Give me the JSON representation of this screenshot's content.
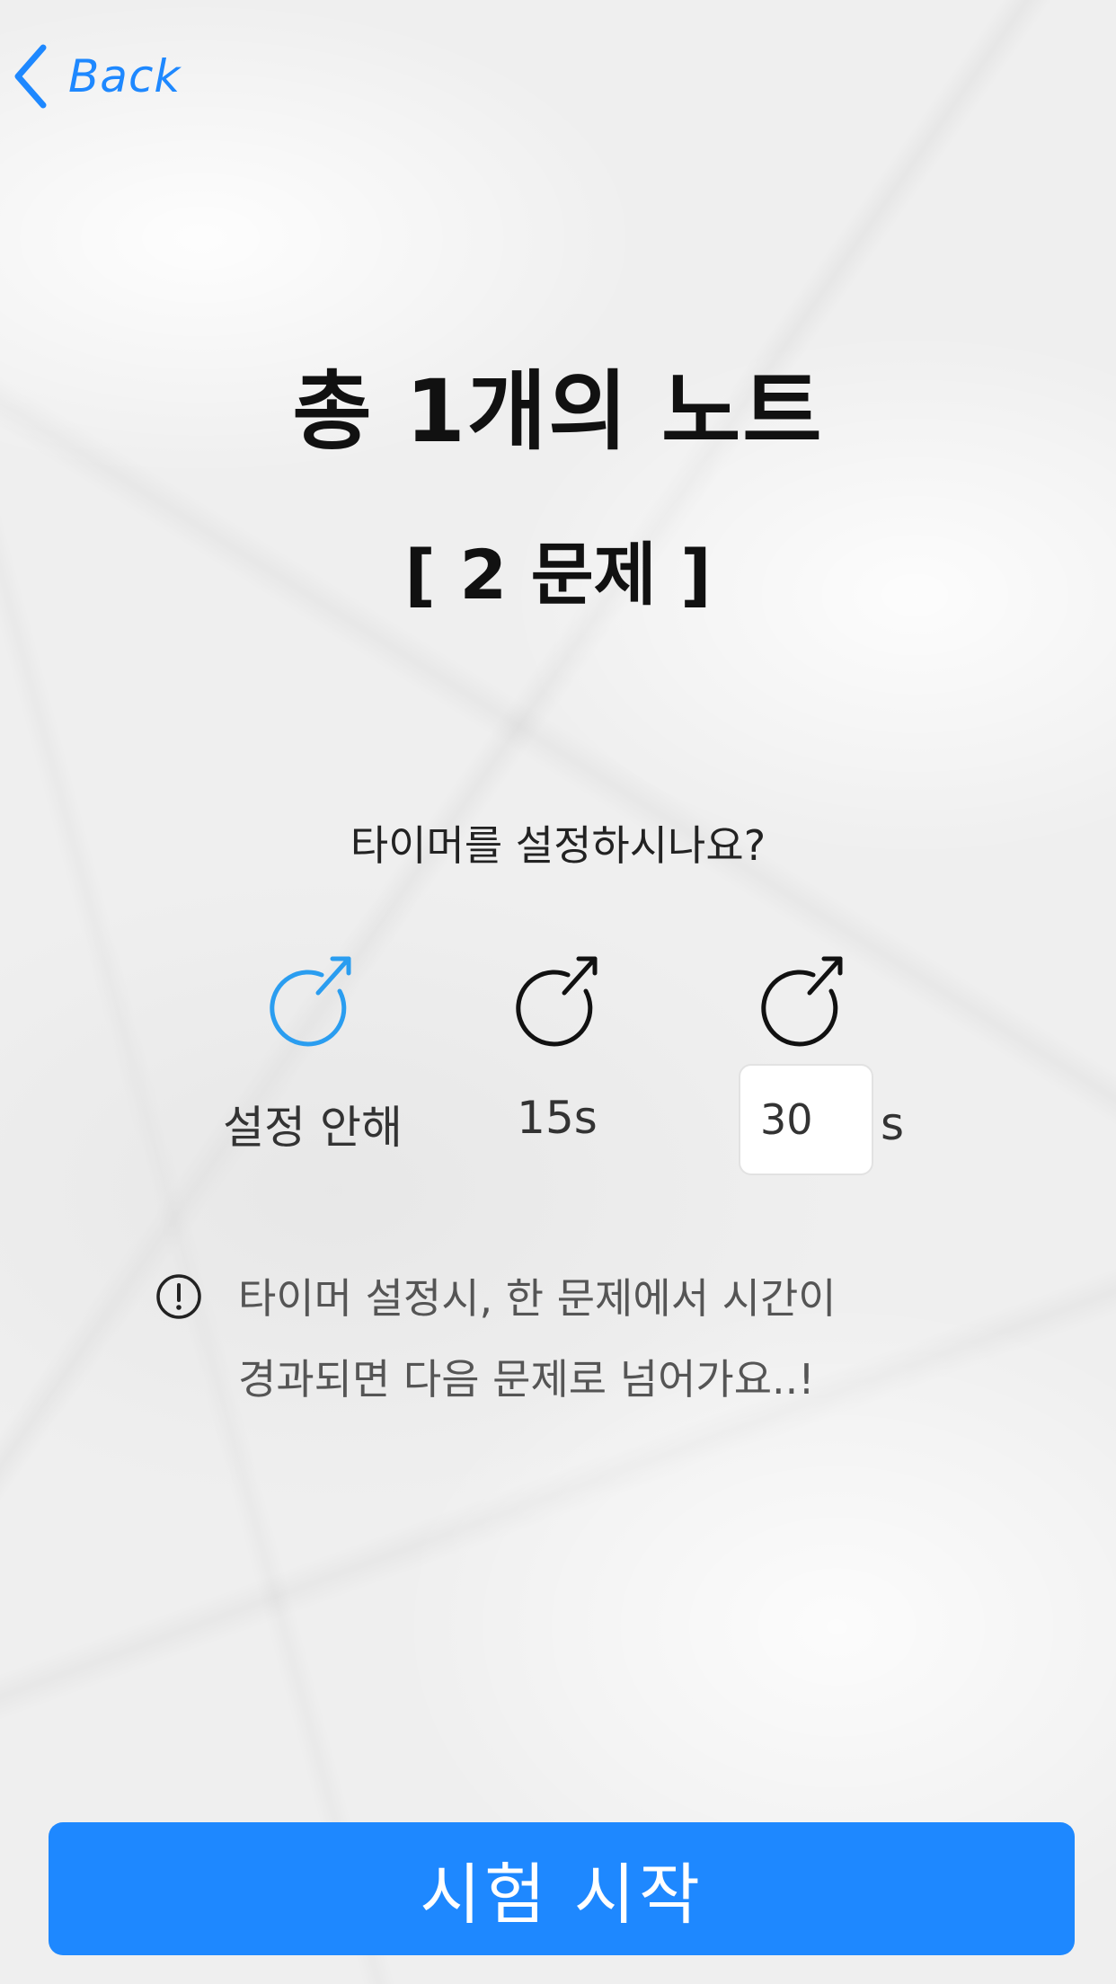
{
  "header": {
    "back_label": "Back"
  },
  "summary": {
    "title": "총 1개의 노트",
    "subtitle": "[ 2 문제 ]"
  },
  "timer": {
    "question": "타이머를 설정하시나요?",
    "options": [
      {
        "label": "설정 안해",
        "selected": true
      },
      {
        "label": "15s",
        "selected": false
      },
      {
        "label": "s",
        "selected": false
      }
    ],
    "custom_value": "30"
  },
  "notice": {
    "line1": "타이머 설정시, 한 문제에서 시간이",
    "line2": "경과되면 다음 문제로 넘어가요..!"
  },
  "actions": {
    "start_label": "시험 시작"
  },
  "colors": {
    "accent": "#1e88ff",
    "selected_icon": "#2a9df0",
    "unselected_icon": "#111111",
    "background": "#efefef"
  }
}
